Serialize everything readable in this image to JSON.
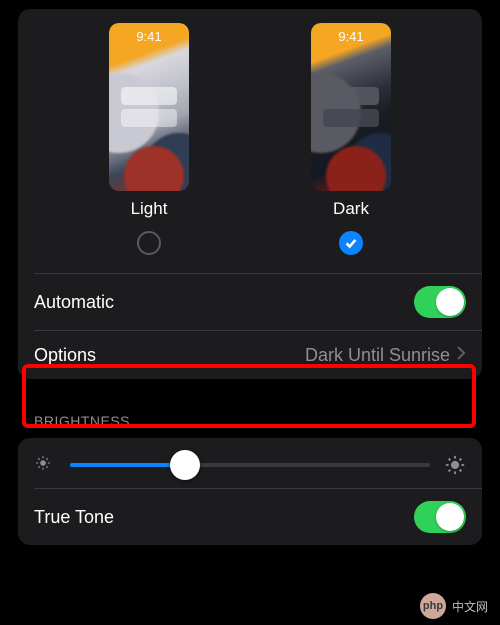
{
  "appearance": {
    "preview_time": "9:41",
    "light_label": "Light",
    "dark_label": "Dark",
    "light_selected": false,
    "dark_selected": true
  },
  "automatic": {
    "label": "Automatic",
    "enabled": true
  },
  "options": {
    "label": "Options",
    "value": "Dark Until Sunrise"
  },
  "brightness": {
    "header": "BRIGHTNESS",
    "value_percent": 32
  },
  "true_tone": {
    "label": "True Tone",
    "enabled": true
  },
  "watermark": {
    "logo_text": "php",
    "site_text": "中文网"
  }
}
